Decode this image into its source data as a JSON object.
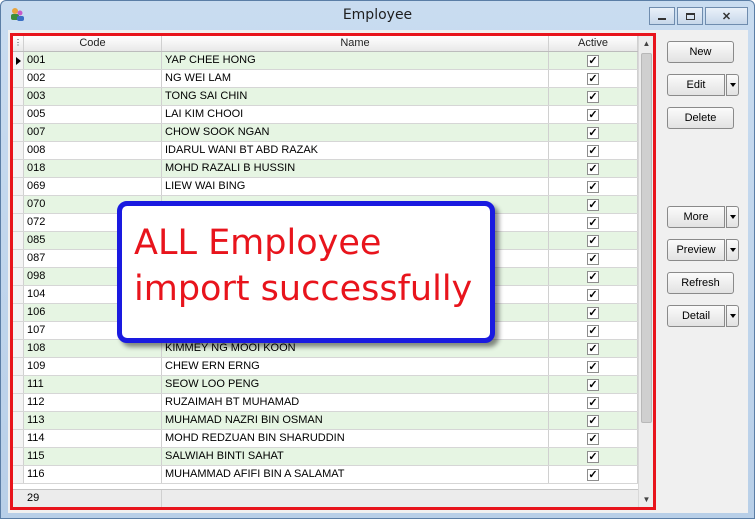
{
  "window": {
    "title": "Employee"
  },
  "grid": {
    "columns": {
      "code": "Code",
      "name": "Name",
      "active": "Active"
    },
    "rows": [
      {
        "code": "001",
        "name": "YAP CHEE HONG",
        "active": true
      },
      {
        "code": "002",
        "name": "NG WEI LAM",
        "active": true
      },
      {
        "code": "003",
        "name": "TONG SAI CHIN",
        "active": true
      },
      {
        "code": "005",
        "name": "LAI KIM CHOOI",
        "active": true
      },
      {
        "code": "007",
        "name": "CHOW SOOK NGAN",
        "active": true
      },
      {
        "code": "008",
        "name": "IDARUL WANI BT ABD RAZAK",
        "active": true
      },
      {
        "code": "018",
        "name": "MOHD RAZALI B HUSSIN",
        "active": true
      },
      {
        "code": "069",
        "name": "LIEW WAI BING",
        "active": true
      },
      {
        "code": "070",
        "name": "",
        "active": true
      },
      {
        "code": "072",
        "name": "",
        "active": true
      },
      {
        "code": "085",
        "name": "",
        "active": true
      },
      {
        "code": "087",
        "name": "",
        "active": true
      },
      {
        "code": "098",
        "name": "",
        "active": true
      },
      {
        "code": "104",
        "name": "",
        "active": true
      },
      {
        "code": "106",
        "name": "",
        "active": true
      },
      {
        "code": "107",
        "name": "",
        "active": true
      },
      {
        "code": "108",
        "name": "KIMMEY NG MOOI KOON",
        "active": true
      },
      {
        "code": "109",
        "name": "CHEW ERN ERNG",
        "active": true
      },
      {
        "code": "111",
        "name": "SEOW LOO PENG",
        "active": true
      },
      {
        "code": "112",
        "name": "RUZAIMAH BT MUHAMAD",
        "active": true
      },
      {
        "code": "113",
        "name": "MUHAMAD NAZRI BIN OSMAN",
        "active": true
      },
      {
        "code": "114",
        "name": "MOHD REDZUAN BIN SHARUDDIN",
        "active": true
      },
      {
        "code": "115",
        "name": "SALWIAH BINTI SAHAT",
        "active": true
      },
      {
        "code": "116",
        "name": "MUHAMMAD AFIFI BIN A SALAMAT",
        "active": true
      }
    ],
    "record_count": "29"
  },
  "buttons": {
    "new": "New",
    "edit": "Edit",
    "delete": "Delete",
    "more": "More",
    "preview": "Preview",
    "refresh": "Refresh",
    "detail": "Detail"
  },
  "callout": {
    "line1": "ALL Employee",
    "line2": "import successfully"
  },
  "colors": {
    "highlight_border": "#e8141c",
    "callout_border": "#1a1ae0",
    "callout_text": "#e8141c",
    "row_alt": "#e6f5e3"
  }
}
